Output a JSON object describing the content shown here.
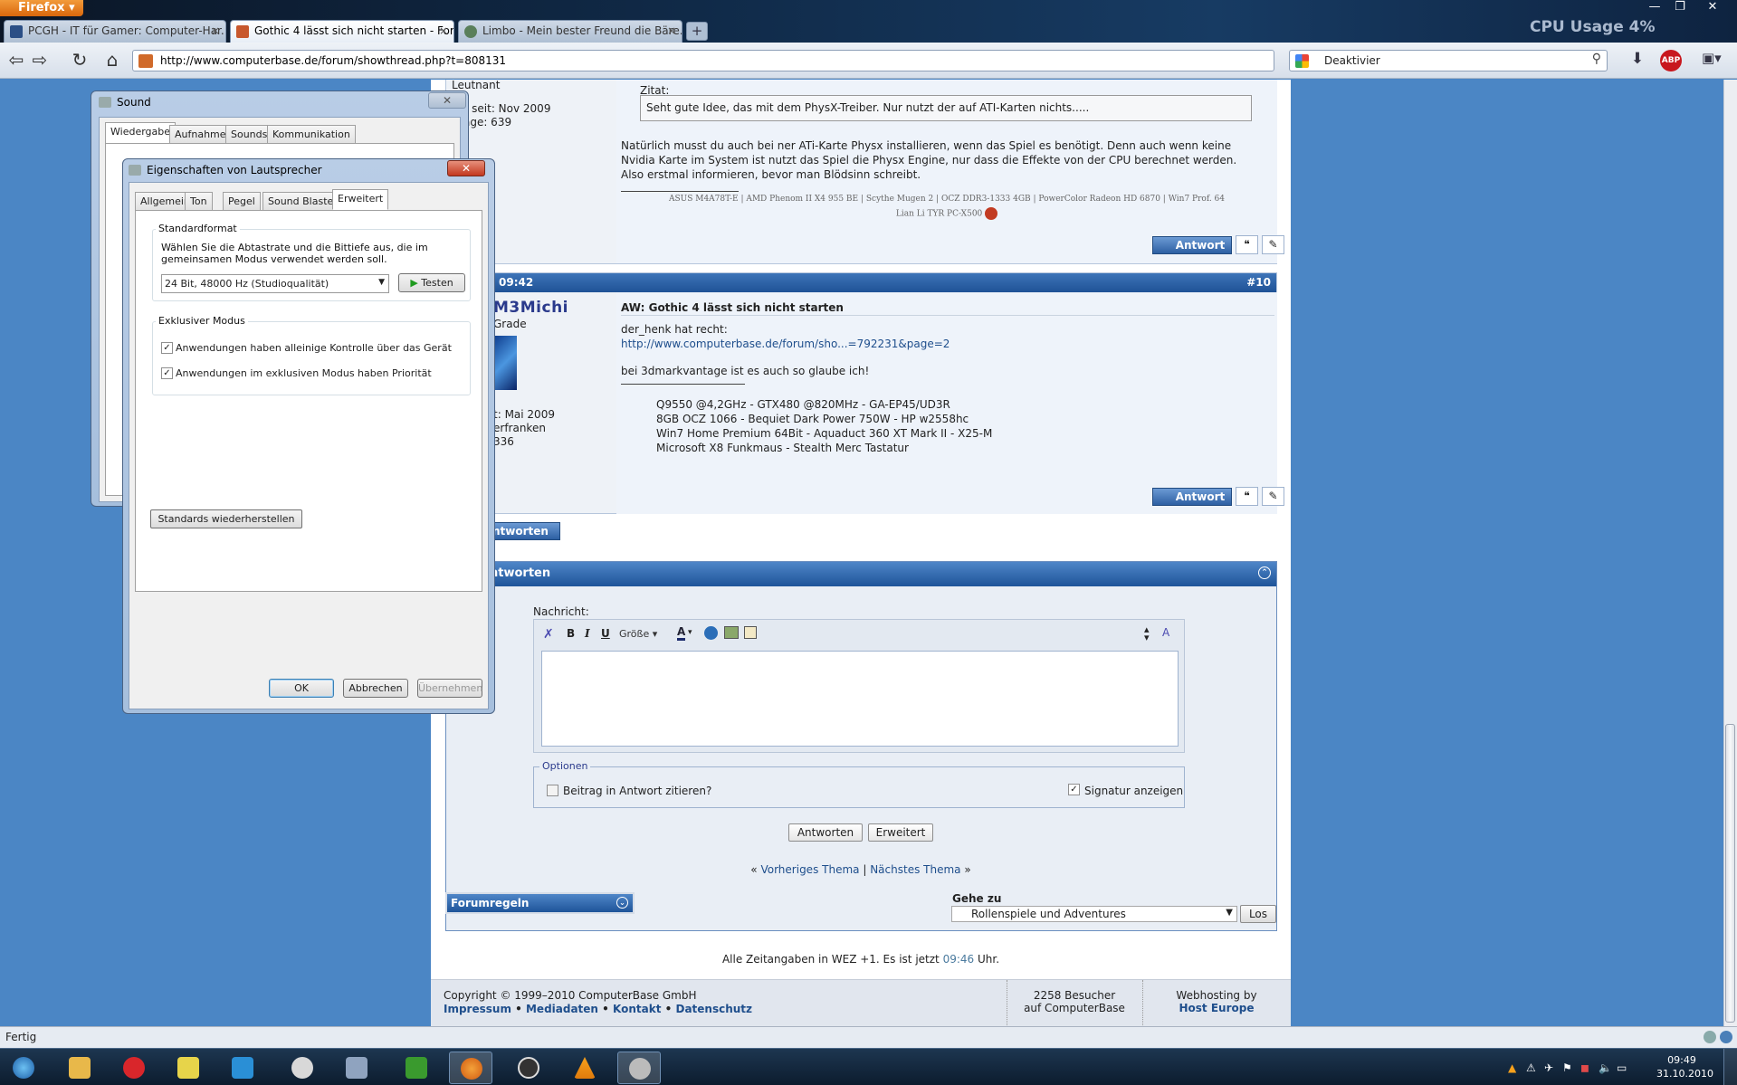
{
  "browser": {
    "menu_label": "Firefox",
    "tabs": [
      {
        "label": "PCGH - IT für Gamer: Computer-Har..."
      },
      {
        "label": "Gothic 4 lässt sich nicht starten - For..."
      },
      {
        "label": "Limbo - Mein bester Freund die Bäre..."
      }
    ],
    "new_tab": "+",
    "url": "http://www.computerbase.de/forum/showthread.php?t=808131",
    "search_text": "Deaktivier",
    "abp_label": "ABP",
    "cpu_widget": "CPU Usage   4%"
  },
  "post1": {
    "left_lines": [
      "Leutnant",
      "bei seit: Nov 2009",
      "iträge: 639"
    ],
    "quote_label": "Zitat:",
    "quote_text": "Seht gute Idee, das mit dem PhysX-Treiber. Nur nutzt der auf ATI-Karten nichts.....",
    "body": [
      "Natürlich musst du auch bei ner ATi-Karte Physx installieren, wenn das Spiel es benötigt. Denn auch wenn keine",
      "Nvidia Karte im System ist nutzt das Spiel die Physx Engine, nur dass die Effekte von der CPU berechnet werden.",
      "Also erstmal informieren, bevor man Blödsinn schreibt."
    ],
    "sig_line1": "ASUS M4A78T-E | AMD Phenom II X4 955 BE | Scythe Mugen 2 | OCZ DDR3-1333 4GB | PowerColor Radeon HD 6870 | Win7 Prof. 64",
    "sig_line2": "Lian Li TYR PC-X500",
    "reply_label": "Antwort"
  },
  "post2": {
    "time": "09:42",
    "number": "#10",
    "username": "M3Michi",
    "rank": "Grade",
    "left_lines": [
      "t: Mai 2009",
      "erfranken",
      "336"
    ],
    "title": "AW: Gothic 4 lässt sich nicht starten",
    "body1": "der_henk hat recht:",
    "link": "http://www.computerbase.de/forum/sho...=792231&page=2",
    "body2": "bei 3dmarkvantage ist es auch so glaube ich!",
    "sig": [
      "Q9550 @4,2GHz - GTX480 @820MHz - GA-EP45/UD3R",
      "8GB OCZ 1066 - Bequiet Dark Power 750W - HP w2558hc",
      "Win7 Home Premium 64Bit - Aquaduct 360 XT Mark II - X25-M",
      "Microsoft X8 Funkmaus - Stealth Merc Tastatur"
    ],
    "reply_label": "Antwort"
  },
  "reply_button": "ntworten",
  "quick_reply": {
    "title": "ntworten",
    "message_label": "Nachricht:",
    "font_size_label": "Größe",
    "options_legend": "Optionen",
    "quote_option": "Beitrag in Antwort zitieren?",
    "signature_option": "Signatur anzeigen",
    "submit": "Antworten",
    "advanced": "Erweitert"
  },
  "thread_nav": {
    "prev": "Vorheriges Thema",
    "sep": "|",
    "next": "Nächstes Thema",
    "lq": "«",
    "rq": "»"
  },
  "forumrules": "Forumregeln",
  "goto": {
    "label": "Gehe zu",
    "selected": "Rollenspiele und Adventures",
    "button": "Los"
  },
  "timezone": {
    "prefix": "Alle Zeitangaben in WEZ +1. Es ist jetzt",
    "time": "09:46",
    "suffix": "Uhr."
  },
  "footer": {
    "copyright": "Copyright © 1999–2010 ComputerBase GmbH",
    "links": [
      "Impressum",
      "Mediadaten",
      "Kontakt",
      "Datenschutz"
    ],
    "visitors1": "2258 Besucher",
    "visitors2": "auf ComputerBase",
    "hosting1": "Webhosting by",
    "hosting2": "Host Europe"
  },
  "status_text": "Fertig",
  "sound_dialog": {
    "title": "Sound",
    "tabs": [
      "Wiedergabe",
      "Aufnahme",
      "Sounds",
      "Kommunikation"
    ]
  },
  "speaker_dialog": {
    "title": "Eigenschaften von Lautsprecher",
    "tabs": [
      "Allgemein",
      "Ton",
      "Pegel",
      "Sound Blaster",
      "Erweitert"
    ],
    "group1_label": "Standardformat",
    "group1_desc1": "Wählen Sie die Abtastrate und die Bittiefe aus, die im",
    "group1_desc2": "gemeinsamen Modus verwendet werden soll.",
    "format_selected": "24 Bit, 48000 Hz (Studioqualität)",
    "test_button": "Testen",
    "group2_label": "Exklusiver Modus",
    "check1": "Anwendungen haben alleinige Kontrolle über das Gerät",
    "check2": "Anwendungen im exklusiven Modus haben Priorität",
    "restore_button": "Standards wiederherstellen",
    "ok": "OK",
    "cancel": "Abbrechen",
    "apply": "Übernehmen"
  },
  "clock": {
    "time": "09:49",
    "date": "31.10.2010"
  }
}
